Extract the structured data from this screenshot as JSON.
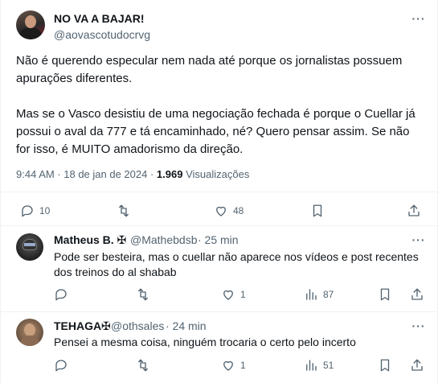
{
  "tweet": {
    "author_name": "NO VA A BAJAR!",
    "author_handle": "@aovascotudocrvg",
    "paragraph1": "Não é querendo especular nem nada até porque os jornalistas possuem apurações diferentes.",
    "paragraph2": "Mas se o Vasco desistiu de uma negociação fechada é porque o Cuellar já possui o aval da 777 e tá encaminhado, né? Quero pensar assim. Se não for isso, é MUITO amadorismo da direção.",
    "time": "9:44 AM · 18 de jan de 2024 ·",
    "views_count": "1.969",
    "views_label": "Visualizações",
    "replies": "10",
    "likes": "48"
  },
  "replies": [
    {
      "name": "Matheus B. ✠",
      "handle": "@Mathebdsb",
      "time": "· 25 min",
      "text": "Pode ser besteira, mas o cuellar não aparece nos vídeos e post recentes dos treinos do al shabab",
      "likes": "1",
      "views": "87"
    },
    {
      "name": "TEHAGA✠",
      "handle": "@othsales",
      "time": "· 24 min",
      "text": "Pensei a mesma coisa, ninguém trocaria o certo pelo incerto",
      "likes": "1",
      "views": "51"
    }
  ],
  "icons": {
    "more": "ellipsis-icon",
    "reply": "reply-icon",
    "retweet": "retweet-icon",
    "like": "heart-icon",
    "bookmark": "bookmark-icon",
    "share": "share-icon",
    "views": "views-bar-icon"
  },
  "colors": {
    "text_primary": "#0f1419",
    "text_secondary": "#536471",
    "divider": "#eff3f4"
  }
}
